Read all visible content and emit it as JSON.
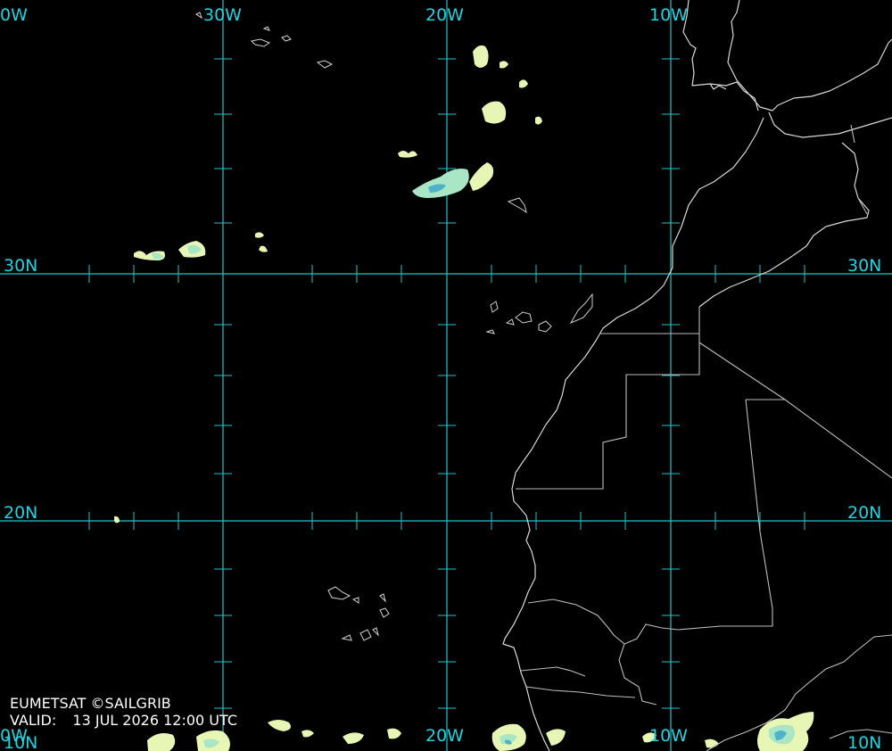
{
  "credit": "EUMETSAT ©SAILGRIB",
  "valid_label": "VALID:",
  "valid_time": "13 JUL 2026 12:00 UTC",
  "grid_labels": {
    "top": [
      "0W",
      "30W",
      "20W",
      "10W"
    ],
    "bottom": [
      "0W",
      "20W",
      "10W",
      "10N"
    ],
    "left": [
      "30N",
      "20N",
      "10N"
    ],
    "right": [
      "30N",
      "20N",
      "10N"
    ]
  },
  "colors": {
    "grid": "#1fc6c8",
    "coastline": "#d8d8d8",
    "cloud_low": "#e7f6b5",
    "cloud_mid": "#a9e6c6",
    "cloud_high": "#4fb2c8"
  }
}
